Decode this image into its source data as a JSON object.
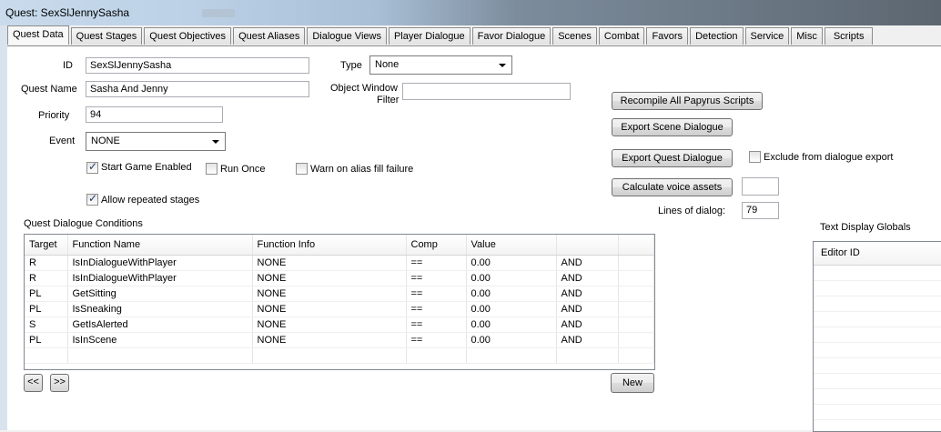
{
  "window": {
    "title": "Quest: SexSlJennySasha"
  },
  "tabs": [
    "Quest Data",
    "Quest Stages",
    "Quest Objectives",
    "Quest Aliases",
    "Dialogue Views",
    "Player Dialogue",
    "Favor Dialogue",
    "Scenes",
    "Combat",
    "Favors",
    "Detection",
    "Service",
    "Misc",
    "Scripts"
  ],
  "form": {
    "id_label": "ID",
    "id_value": "SexSlJennySasha",
    "name_label": "Quest Name",
    "name_value": "Sasha And Jenny",
    "priority_label": "Priority",
    "priority_value": "94",
    "event_label": "Event",
    "event_value": "NONE",
    "type_label": "Type",
    "type_value": "None",
    "owf_label_1": "Object Window",
    "owf_label_2": "Filter",
    "owf_value": "",
    "start_game_enabled": "Start Game Enabled",
    "run_once": "Run Once",
    "warn_alias": "Warn on alias fill failure",
    "allow_repeated": "Allow repeated stages"
  },
  "buttons": {
    "recompile": "Recompile All Papyrus Scripts",
    "export_scene": "Export Scene Dialogue",
    "export_quest": "Export Quest Dialogue",
    "calc_voice": "Calculate voice assets",
    "new": "New",
    "prev": "<<",
    "next": ">>"
  },
  "export_options": {
    "exclude_label": "Exclude from dialogue export",
    "voice_assets_value": ""
  },
  "lines_of_dialog": {
    "label": "Lines of dialog:",
    "value": "79"
  },
  "conditions": {
    "title": "Quest Dialogue Conditions",
    "columns": [
      "Target",
      "Function Name",
      "Function Info",
      "Comp",
      "Value",
      ""
    ],
    "rows": [
      [
        "R",
        "IsInDialogueWithPlayer",
        "NONE",
        "==",
        "0.00",
        "AND"
      ],
      [
        "R",
        "IsInDialogueWithPlayer",
        "NONE",
        "==",
        "0.00",
        "AND"
      ],
      [
        "PL",
        "GetSitting",
        "NONE",
        "==",
        "0.00",
        "AND"
      ],
      [
        "PL",
        "IsSneaking",
        "NONE",
        "==",
        "0.00",
        "AND"
      ],
      [
        "S",
        "GetIsAlerted",
        "NONE",
        "==",
        "0.00",
        "AND"
      ],
      [
        "PL",
        "IsInScene",
        "NONE",
        "==",
        "0.00",
        "AND"
      ]
    ]
  },
  "globals": {
    "title": "Text Display Globals",
    "column": "Editor ID"
  }
}
